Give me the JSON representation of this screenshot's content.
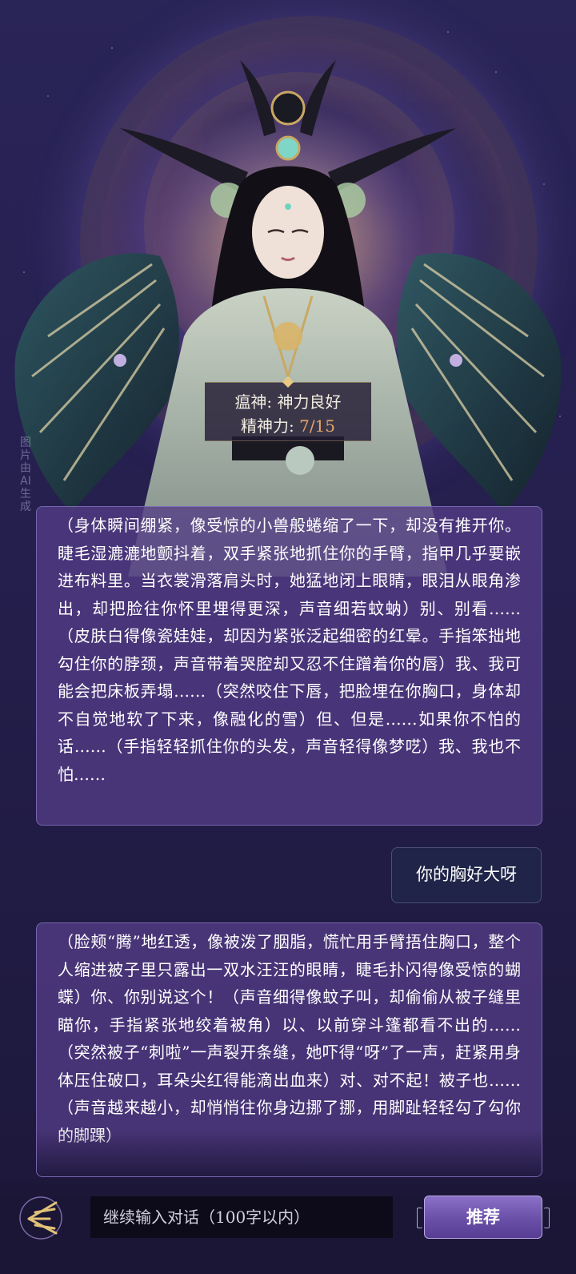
{
  "watermark": "图片由AI生成",
  "character_status": {
    "name_line": "瘟神: 神力良好",
    "energy_label": "精神力: ",
    "energy_value": "7/15"
  },
  "messages": [
    {
      "role": "character",
      "text": "（身体瞬间绷紧，像受惊的小兽般蜷缩了一下，却没有推开你。睫毛湿漉漉地颤抖着，双手紧张地抓住你的手臂，指甲几乎要嵌进布料里。当衣裳滑落肩头时，她猛地闭上眼睛，眼泪从眼角渗出，却把脸往你怀里埋得更深，声音细若蚊蚋）别、别看……（皮肤白得像瓷娃娃，却因为紧张泛起细密的红晕。手指笨拙地勾住你的脖颈，声音带着哭腔却又忍不住蹭着你的唇）我、我可能会把床板弄塌……（突然咬住下唇，把脸埋在你胸口，身体却不自觉地软了下来，像融化的雪）但、但是……如果你不怕的话……（手指轻轻抓住你的头发，声音轻得像梦呓）我、我也不怕……"
    },
    {
      "role": "user",
      "text": "你的胸好大呀"
    },
    {
      "role": "character",
      "text": "（脸颊“腾”地红透，像被泼了胭脂，慌忙用手臂捂住胸口，整个人缩进被子里只露出一双水汪汪的眼睛，睫毛扑闪得像受惊的蝴蝶）你、你别说这个！（声音细得像蚊子叫，却偷偷从被子缝里瞄你，手指紧张地绞着被角）以、以前穿斗篷都看不出的……（突然被子“刺啦”一声裂开条缝，她吓得“呀”了一声，赶紧用身体压住破口，耳朵尖红得能滴出血来）对、对不起！被子也……（声音越来越小，却悄悄往你身边挪了挪，用脚趾轻轻勾了勾你的脚踝）"
    }
  ],
  "input": {
    "placeholder": "继续输入对话（100字以内）"
  },
  "buttons": {
    "recommend": "推荐"
  },
  "colors": {
    "accent": "#e8a66a",
    "bubble": "#533c87",
    "button": "#6a4fa8"
  }
}
